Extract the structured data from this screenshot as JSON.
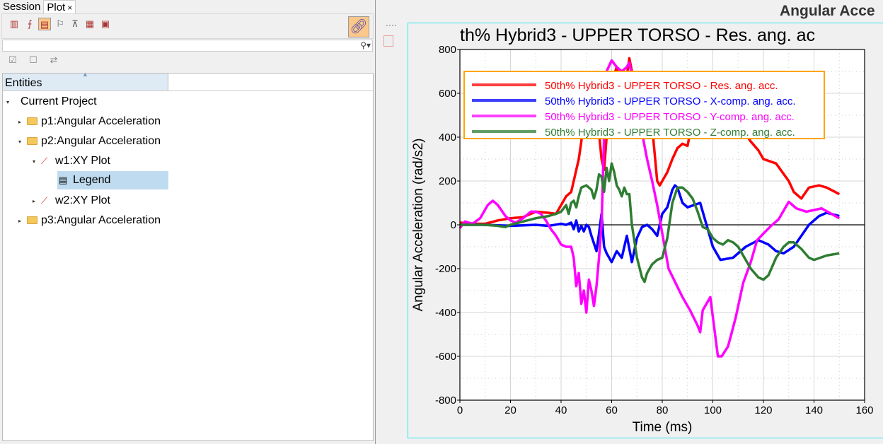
{
  "left_panel": {
    "tabs": [
      {
        "label": "Session"
      },
      {
        "label": "Plot",
        "close": "×"
      }
    ],
    "toolbar_icons": [
      "plot-icon",
      "curve-icon",
      "axis-icon",
      "note-icon",
      "datum-icon",
      "grid-icon",
      "legend-window-icon"
    ],
    "link_icon": "link-icon",
    "search": {
      "value": "",
      "placeholder": ""
    },
    "tree": {
      "column_header": "Entities",
      "items": [
        {
          "label": "Current Project",
          "level": 0,
          "expanded": true,
          "type": "project"
        },
        {
          "label": "p1:Angular Acceleration",
          "level": 1,
          "expanded": false,
          "type": "folder"
        },
        {
          "label": "p2:Angular Acceleration",
          "level": 1,
          "expanded": true,
          "type": "folder"
        },
        {
          "label": "w1:XY Plot",
          "level": 2,
          "expanded": true,
          "type": "plot"
        },
        {
          "label": "Legend",
          "level": 3,
          "selected": true,
          "type": "legend"
        },
        {
          "label": "w2:XY Plot",
          "level": 2,
          "expanded": false,
          "type": "plot"
        },
        {
          "label": "p3:Angular Acceleration",
          "level": 1,
          "expanded": false,
          "type": "folder"
        }
      ]
    }
  },
  "page_title": "Angular Acce",
  "chart_data": {
    "type": "line",
    "title": "th% Hybrid3   - UPPER TORSO - Res. ang. ac",
    "xlabel": "Time (ms)",
    "ylabel": "Angular Acceleration (rad/s2)",
    "xlim": [
      0,
      160
    ],
    "ylim": [
      -800,
      800
    ],
    "xticks": [
      0,
      20,
      40,
      60,
      80,
      100,
      120,
      140,
      160
    ],
    "yticks": [
      -800,
      -600,
      -400,
      -200,
      0,
      200,
      400,
      600,
      800
    ],
    "grid": true,
    "legend_position": "top-left",
    "series": [
      {
        "name": "50th% Hybrid3   - UPPER TORSO - Res. ang. acc.",
        "color": "#ff0000",
        "x": [
          0,
          5,
          10,
          15,
          20,
          25,
          30,
          35,
          38,
          40,
          42,
          44,
          45,
          46,
          47,
          48,
          49,
          50,
          51,
          52,
          53,
          54,
          55,
          56,
          57,
          58,
          59,
          60,
          62,
          64,
          66,
          67,
          68,
          70,
          72,
          74,
          76,
          78,
          79,
          80,
          82,
          84,
          86,
          88,
          90,
          91,
          92,
          95,
          100,
          105,
          110,
          112,
          115,
          118,
          120,
          125,
          130,
          132,
          135,
          138,
          142,
          145,
          150
        ],
        "y": [
          10,
          5,
          5,
          20,
          30,
          35,
          60,
          55,
          50,
          90,
          130,
          150,
          200,
          250,
          300,
          380,
          480,
          550,
          420,
          500,
          450,
          500,
          420,
          300,
          250,
          400,
          560,
          650,
          720,
          600,
          680,
          760,
          700,
          650,
          600,
          550,
          450,
          200,
          180,
          200,
          240,
          300,
          350,
          370,
          360,
          420,
          500,
          620,
          660,
          600,
          500,
          430,
          380,
          340,
          300,
          280,
          200,
          150,
          120,
          170,
          180,
          170,
          140
        ]
      },
      {
        "name": "50th% Hybrid3   - UPPER TORSO - X-comp. ang. acc.",
        "color": "#0000ff",
        "x": [
          0,
          10,
          20,
          30,
          35,
          40,
          42,
          44,
          45,
          46,
          47,
          48,
          49,
          50,
          51,
          52,
          54,
          55,
          56,
          57,
          58,
          60,
          62,
          64,
          66,
          68,
          70,
          72,
          74,
          76,
          78,
          80,
          82,
          84,
          85,
          86,
          88,
          90,
          95,
          100,
          103,
          108,
          113,
          118,
          122,
          125,
          128,
          132,
          135,
          138,
          142,
          145,
          150
        ],
        "y": [
          0,
          0,
          -5,
          0,
          -5,
          5,
          0,
          10,
          -20,
          20,
          -30,
          -5,
          -30,
          0,
          -10,
          -50,
          -120,
          -40,
          50,
          -100,
          -130,
          -170,
          -120,
          -150,
          -50,
          -170,
          -60,
          -10,
          0,
          -20,
          -50,
          50,
          80,
          160,
          180,
          170,
          100,
          80,
          100,
          -100,
          -160,
          -150,
          -100,
          -70,
          -90,
          -120,
          -130,
          -100,
          -50,
          0,
          40,
          55,
          40
        ]
      },
      {
        "name": "50th% Hybrid3   - UPPER TORSO - Y-comp. ang. acc.",
        "color": "#ff00ff",
        "x": [
          0,
          2,
          5,
          8,
          11,
          13,
          15,
          18,
          20,
          22,
          25,
          28,
          30,
          32,
          34,
          36,
          38,
          40,
          42,
          44,
          45,
          46,
          47,
          48,
          49,
          50,
          51,
          52,
          53,
          54,
          55,
          56,
          57,
          58,
          60,
          62,
          64,
          66,
          67,
          70,
          72,
          74,
          76,
          78,
          82.5,
          88,
          91,
          94,
          95,
          96,
          99,
          102,
          103.5,
          106,
          109,
          112,
          115,
          117.5,
          120,
          123,
          126,
          130,
          133,
          137,
          143,
          150
        ],
        "y": [
          -15,
          15,
          5,
          30,
          90,
          110,
          90,
          40,
          20,
          10,
          30,
          60,
          60,
          50,
          20,
          -20,
          -50,
          -90,
          -100,
          -100,
          -150,
          -280,
          -220,
          -360,
          -300,
          -400,
          -250,
          -300,
          -370,
          -280,
          -150,
          0,
          400,
          700,
          750,
          720,
          700,
          720,
          740,
          560,
          420,
          300,
          200,
          90,
          -200,
          -330,
          -390,
          -460,
          -490,
          -390,
          -330,
          -600,
          -600,
          -555,
          -425,
          -265,
          -170,
          -70,
          -40,
          -5,
          25,
          105,
          75,
          60,
          75,
          30
        ]
      },
      {
        "name": "50th% Hybrid3   - UPPER TORSO - Z-comp. ang. acc.",
        "color": "#2e7d32",
        "x": [
          0,
          10,
          15,
          18,
          20,
          25,
          30,
          35,
          38,
          40,
          42,
          43,
          44,
          45,
          46,
          47,
          48,
          50,
          52,
          53,
          54,
          55,
          56,
          57,
          58,
          59,
          60,
          61,
          62,
          63,
          64,
          65,
          66,
          67,
          68,
          70,
          72,
          73,
          74,
          76,
          78,
          80,
          82,
          84,
          86,
          88,
          90,
          92,
          94,
          96,
          98,
          100,
          102,
          104,
          106,
          108,
          110,
          112,
          115,
          118,
          120,
          122,
          125,
          128,
          130,
          132,
          135,
          138,
          140,
          145,
          150
        ],
        "y": [
          0,
          0,
          -5,
          -10,
          0,
          15,
          30,
          40,
          50,
          60,
          90,
          50,
          100,
          110,
          80,
          130,
          170,
          180,
          160,
          120,
          160,
          230,
          220,
          150,
          260,
          200,
          280,
          240,
          180,
          160,
          130,
          170,
          140,
          140,
          0,
          -150,
          -240,
          -260,
          -220,
          -180,
          -160,
          -150,
          -60,
          100,
          170,
          170,
          150,
          120,
          60,
          -10,
          -20,
          -60,
          -80,
          -90,
          -70,
          -80,
          -100,
          -140,
          -200,
          -240,
          -250,
          -230,
          -150,
          -100,
          -80,
          -80,
          -110,
          -150,
          -160,
          -140,
          -130
        ]
      }
    ]
  }
}
